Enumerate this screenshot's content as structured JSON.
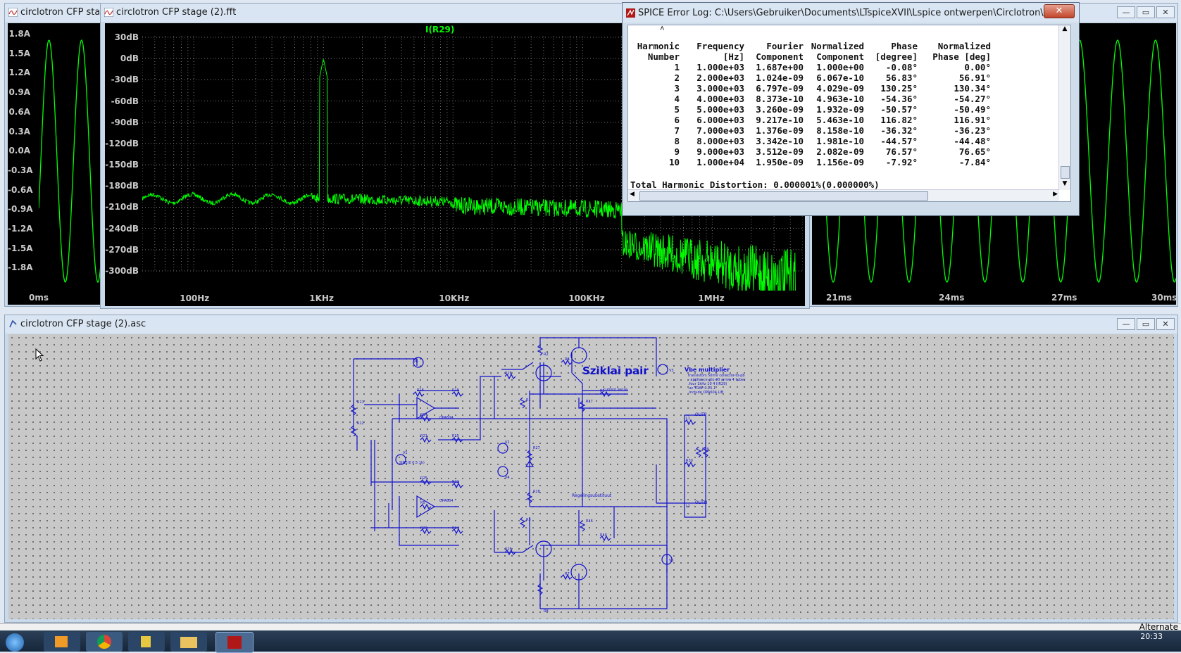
{
  "colors": {
    "trace": "#00ff00",
    "plot_bg": "#000000",
    "wire": "#0000cc",
    "schem_bg": "#c8c8c8"
  },
  "left_window": {
    "title": "circlotron CFP stage",
    "y_ticks": [
      "1.8A",
      "1.5A",
      "1.2A",
      "0.9A",
      "0.6A",
      "0.3A",
      "0.0A",
      "-0.3A",
      "-0.6A",
      "-0.9A",
      "-1.2A",
      "-1.5A",
      "-1.8A"
    ],
    "x_ticks": [
      "0ms"
    ]
  },
  "fft_window": {
    "title": "circlotron CFP stage (2).fft",
    "trace_label": "I(R29)",
    "y_ticks": [
      "30dB",
      "0dB",
      "-30dB",
      "-60dB",
      "-90dB",
      "-120dB",
      "-150dB",
      "-180dB",
      "-210dB",
      "-240dB",
      "-270dB",
      "-300dB"
    ],
    "x_ticks": [
      "100Hz",
      "1KHz",
      "10KHz",
      "100KHz",
      "1MHz"
    ]
  },
  "right_window": {
    "x_ticks": [
      "21ms",
      "24ms",
      "27ms",
      "30ms"
    ]
  },
  "error_log": {
    "title": "SPICE Error Log: C:\\Users\\Gebruiker\\Documents\\LTspiceXVII\\Lspice ontwerpen\\Circlotron\\circlotron CFP ...",
    "close_label": "✕",
    "headers": [
      [
        "Harmonic",
        "Number"
      ],
      [
        "Frequency",
        "[Hz]"
      ],
      [
        "Fourier",
        "Component"
      ],
      [
        "Normalized",
        "Component"
      ],
      [
        "Phase",
        "[degree]"
      ],
      [
        "Normalized",
        "Phase [deg]"
      ]
    ],
    "rows": [
      [
        "1",
        "1.000e+03",
        "1.687e+00",
        "1.000e+00",
        "-0.08°",
        "0.00°"
      ],
      [
        "2",
        "2.000e+03",
        "1.024e-09",
        "6.067e-10",
        "56.83°",
        "56.91°"
      ],
      [
        "3",
        "3.000e+03",
        "6.797e-09",
        "4.029e-09",
        "130.25°",
        "130.34°"
      ],
      [
        "4",
        "4.000e+03",
        "8.373e-10",
        "4.963e-10",
        "-54.36°",
        "-54.27°"
      ],
      [
        "5",
        "5.000e+03",
        "3.260e-09",
        "1.932e-09",
        "-50.57°",
        "-50.49°"
      ],
      [
        "6",
        "6.000e+03",
        "9.217e-10",
        "5.463e-10",
        "116.82°",
        "116.91°"
      ],
      [
        "7",
        "7.000e+03",
        "1.376e-09",
        "8.158e-10",
        "-36.32°",
        "-36.23°"
      ],
      [
        "8",
        "8.000e+03",
        "3.342e-10",
        "1.981e-10",
        "-44.57°",
        "-44.48°"
      ],
      [
        "9",
        "9.000e+03",
        "3.512e-09",
        "2.082e-09",
        "76.57°",
        "76.65°"
      ],
      [
        "10",
        "1.000e+04",
        "1.950e-09",
        "1.156e-09",
        "-7.92°",
        "-7.84°"
      ]
    ],
    "thd": "Total Harmonic Distortion: 0.000001%(0.000000%)"
  },
  "schematic_window": {
    "title": "circlotron CFP stage (2).asc",
    "labels": {
      "sziklai": "Sziklai pair",
      "vbe": "Vbe multiplier",
      "regeling": "Regelingsubstituut",
      "outp": "OUTP",
      "outn": "OUTN",
      "opamp1": "OPA604",
      "opamp2": "OPA604",
      "source": "SINE(0 0.5 1k)"
    }
  },
  "status": {
    "right_text": "Alternate"
  },
  "taskbar": {
    "clock": "20:33"
  }
}
